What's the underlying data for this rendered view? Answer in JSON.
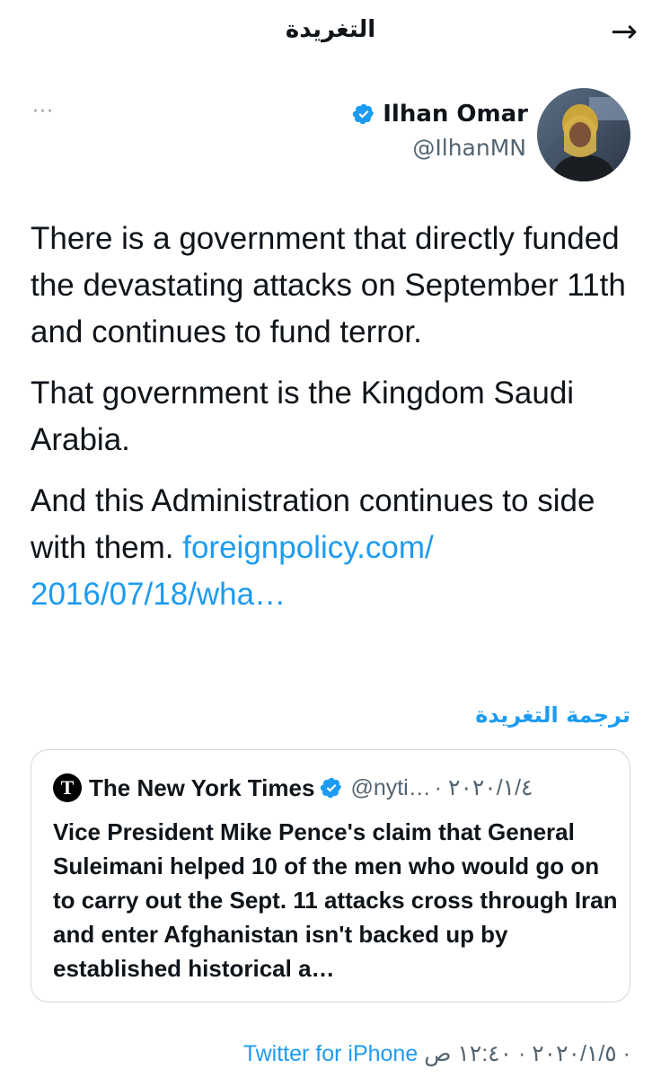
{
  "header": {
    "title": "التغريدة",
    "back_icon": "arrow-right-icon"
  },
  "tweet": {
    "author": {
      "name": "Ilhan Omar",
      "handle": "@IlhanMN",
      "verified": true
    },
    "more_label": "···",
    "paragraphs": [
      "There is a government that directly funded the devastating attacks on September 11th and continues to fund terror.",
      "That government is the Kingdom Saudi Arabia."
    ],
    "last_paragraph_text": "And this Administration continues to side with them.",
    "link_text": "foreignpolicy.com/ 2016/07/18/wha…",
    "translate_label": "ترجمة التغريدة"
  },
  "quote": {
    "name": "The New York Times",
    "handle": "@nyti…",
    "date": "· ٢٠٢٠/١/٤",
    "text": "Vice President Mike Pence's claim that General Suleimani helped 10 of the men who would go on to carry out the Sept. 11 attacks cross through Iran and enter Afghanistan isn't backed up by established historical a…"
  },
  "meta": {
    "date": "٢٠٢٠/١/٥ · ١٢:٤٠ ص ·",
    "source": "Twitter for iPhone"
  },
  "colors": {
    "accent": "#1d9bf0",
    "text": "#0f1419",
    "secondary": "#536471",
    "border": "#cfd9de"
  }
}
